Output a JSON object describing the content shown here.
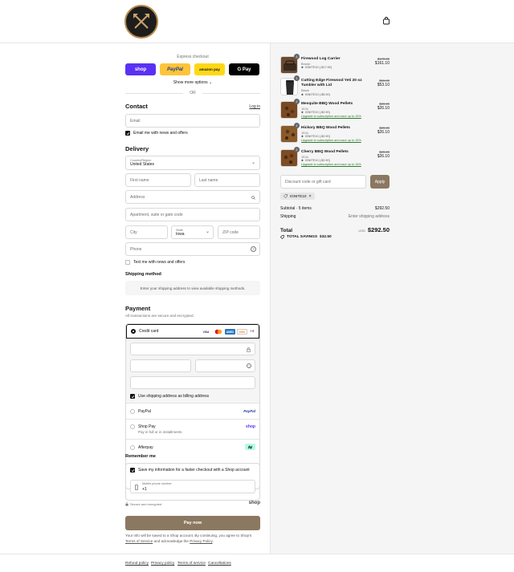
{
  "express": {
    "label": "Express checkout",
    "buttons": [
      {
        "label": "shop",
        "bg": "#5a31f4",
        "color": "#ffffff"
      },
      {
        "label": "PayPal",
        "bg": "#ffc439",
        "color": "#1d3b8f"
      },
      {
        "label": "amazon pay",
        "bg": "#ffd814",
        "color": "#111111"
      },
      {
        "label": "G Pay",
        "bg": "#000000",
        "color": "#ffffff"
      }
    ],
    "show_more": "Show more options",
    "or": "OR"
  },
  "contact": {
    "heading": "Contact",
    "login": "Log in",
    "email_placeholder": "Email",
    "email_news": "Email me with news and offers"
  },
  "delivery": {
    "heading": "Delivery",
    "country_label": "Country/Region",
    "country": "United States",
    "first_name": "First name",
    "last_name": "Last name",
    "address": "Address",
    "apartment": "Apartment, suite or gate code",
    "city": "City",
    "state_label": "State",
    "state": "Iowa",
    "zip": "ZIP code",
    "phone": "Phone",
    "text_news": "Text me with news and offers"
  },
  "shipping": {
    "heading": "Shipping method",
    "info": "Enter your shipping address to view available shipping methods."
  },
  "payment": {
    "heading": "Payment",
    "subheading": "All transactions are secure and encrypted.",
    "credit_card": "Credit card",
    "card_more": "+4",
    "billing": "Use shipping address as billing address",
    "paypal": "PayPal",
    "shoppay": "Shop Pay",
    "shoppay_sub": "Pay in full or in installments",
    "shoppay_logo": "shop",
    "afterpay": "Afterpay",
    "paypal_logo": "PayPal",
    "card_brands": [
      "VISA",
      "MC",
      "AMEX",
      "DISC"
    ]
  },
  "remember": {
    "heading": "Remember me",
    "save": "Save my information for a faster checkout with a Shop account",
    "mobile_label": "Mobile phone number",
    "mobile_value": "+1",
    "secure": "Secure and encrypted",
    "shop_logo": "shop"
  },
  "paynow": "Pay now",
  "disclaimer": {
    "text": "Your info will be saved to a Shop account. By continuing, you agree to Shop's",
    "terms": "Terms of Service",
    "and": "and acknowledge the",
    "privacy": "Privacy Policy"
  },
  "footer": [
    "Refund policy",
    "Privacy policy",
    "Terms of service",
    "Cancellations"
  ],
  "cart": {
    "items": [
      {
        "qty": "1",
        "name": "Firewood Log Carrier",
        "variant": "Brown",
        "discount": "IGNITE10 (-$17.90)",
        "upgrade": "",
        "compare": "$179.00",
        "price": "$161.10"
      },
      {
        "qty": "1",
        "name": "Cutting Edge Firewood Yeti 20 oz Tumbler with Lid",
        "variant": "Black",
        "discount": "IGNITE10 (-$5.90)",
        "upgrade": "",
        "compare": "$59.00",
        "price": "$53.10"
      },
      {
        "qty": "1",
        "name": "Mesquite BBQ Wood Pellets",
        "variant": "15 lb",
        "discount": "IGNITE10 (-$2.90)",
        "upgrade": "Upgrade to subscription and save up to 15%",
        "compare": "$29.00",
        "price": "$26.10"
      },
      {
        "qty": "1",
        "name": "Hickory BBQ Wood Pellets",
        "variant": "15 lb",
        "discount": "IGNITE10 (-$2.90)",
        "upgrade": "Upgrade to subscription and save up to 15%",
        "compare": "$29.00",
        "price": "$26.10"
      },
      {
        "qty": "1",
        "name": "Cherry BBQ Wood Pellets",
        "variant": "15 lb",
        "discount": "IGNITE10 (-$2.90)",
        "upgrade": "Upgrade to subscription and save up to 15%",
        "compare": "$29.00",
        "price": "$26.10"
      }
    ],
    "discount_placeholder": "Discount code or gift card",
    "apply": "Apply",
    "applied_code": "IGNITE10",
    "subtotal_label": "Subtotal · 5 items",
    "subtotal": "$292.50",
    "shipping_label": "Shipping",
    "shipping_value": "Enter shipping address",
    "total_label": "Total",
    "currency": "USD",
    "total": "$292.50",
    "savings_label": "TOTAL SAVINGS",
    "savings": "$32.50"
  }
}
